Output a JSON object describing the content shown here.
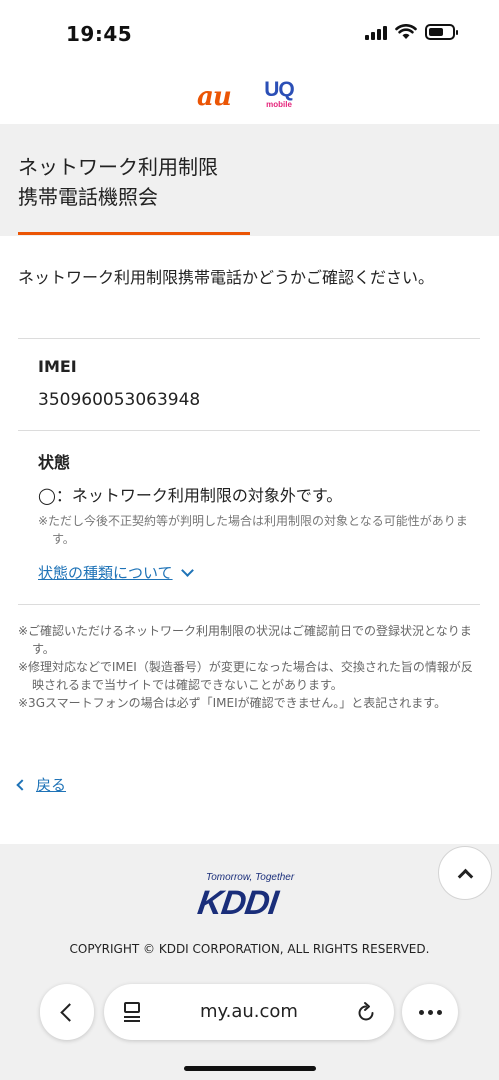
{
  "status_bar": {
    "time": "19:45"
  },
  "brand": {
    "au": "au",
    "uq": "UQ",
    "uq_sub": "mobile"
  },
  "page": {
    "title_line1": "ネットワーク利用制限",
    "title_line2": "携帯電話機照会",
    "intro": "ネットワーク利用制限携帯電話かどうかご確認ください。"
  },
  "imei": {
    "label": "IMEI",
    "value": "350960053063948"
  },
  "status": {
    "label": "状態",
    "value": "◯：ネットワーク利用制限の対象外です。",
    "note": "※ただし今後不正契約等が判明した場合は利用制限の対象となる可能性があります。",
    "link_label": "状態の種類について"
  },
  "notes": [
    "※ご確認いただけるネットワーク利用制限の状況はご確認前日での登録状況となります。",
    "※修理対応などでIMEI（製造番号）が変更になった場合は、交換された旨の情報が反映されるまで当サイトでは確認できないことがあります。",
    "※3Gスマートフォンの場合は必ず「IMEIが確認できません。」と表記されます。"
  ],
  "back_label": "戻る",
  "footer": {
    "tagline": "Tomorrow, Together",
    "logo": "KDDI",
    "copyright": "COPYRIGHT © KDDI CORPORATION, ALL RIGHTS RESERVED."
  },
  "browser": {
    "url": "my.au.com"
  },
  "colors": {
    "accent": "#eb5505",
    "link": "#1f73b7",
    "kddi": "#1a2e7a",
    "uq": "#2b4fb6"
  }
}
